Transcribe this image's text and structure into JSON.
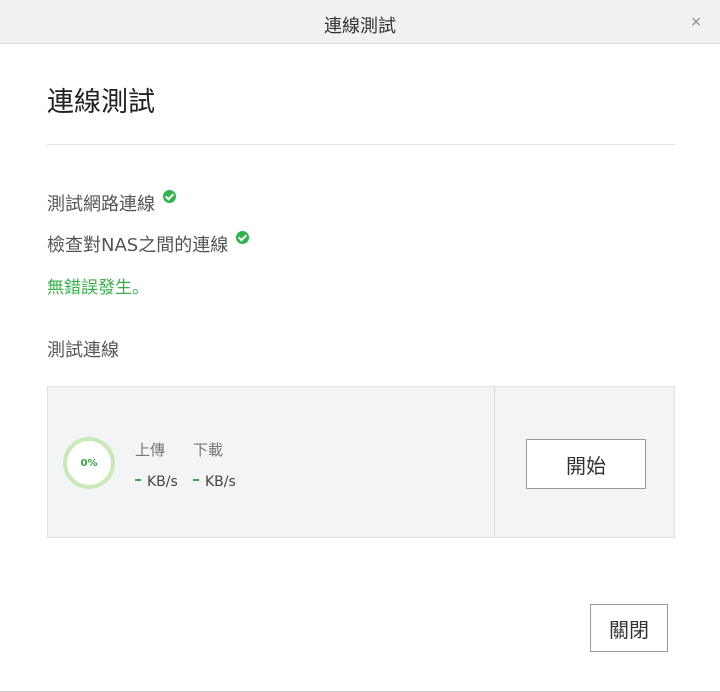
{
  "window": {
    "title": "連線測試",
    "close_icon": "close-icon",
    "close_glyph": "×"
  },
  "content": {
    "heading": "連線測試",
    "checks": [
      {
        "label": "測試網路連線",
        "status": "ok",
        "icon": "check-circle-icon"
      },
      {
        "label": "檢查對NAS之間的連線",
        "status": "ok",
        "icon": "check-circle-icon"
      }
    ],
    "result_message": "無錯誤發生。",
    "speed_section_label": "測試連線"
  },
  "speed_test": {
    "progress": "0%",
    "upload_label": "上傳",
    "download_label": "下載",
    "upload_unit": "KB/s",
    "download_unit": "KB/s",
    "start_button": "開始"
  },
  "footer": {
    "close_button": "關閉"
  },
  "colors": {
    "success": "#2eb54a",
    "titlebar_bg": "#f1f1f1",
    "panel_bg": "#f3f4f6"
  }
}
